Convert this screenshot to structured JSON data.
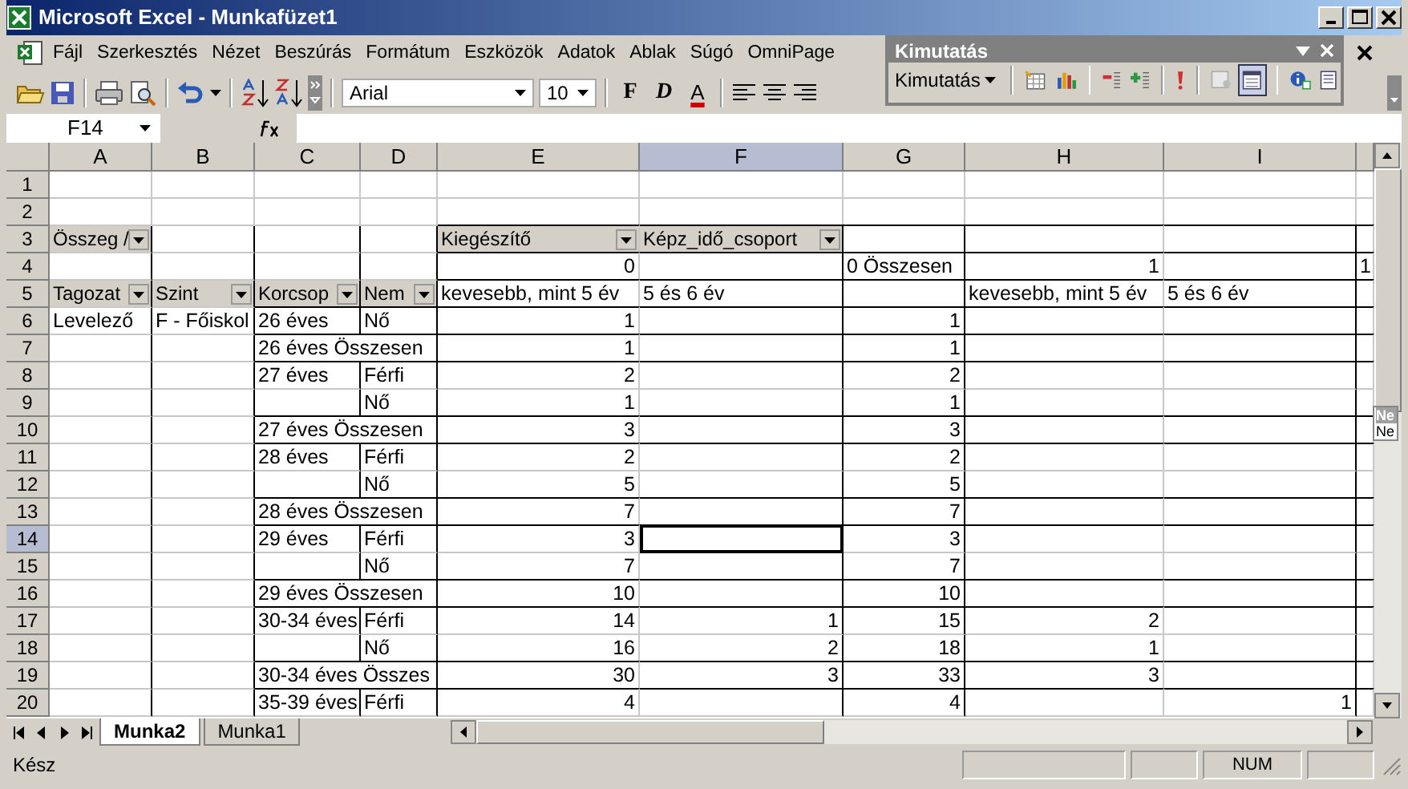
{
  "window": {
    "title": "Microsoft Excel - Munkafüzet1"
  },
  "menu": [
    "Fájl",
    "Szerkesztés",
    "Nézet",
    "Beszúrás",
    "Formátum",
    "Eszközök",
    "Adatok",
    "Ablak",
    "Súgó",
    "OmniPage"
  ],
  "toolbar": {
    "font": "Arial",
    "size": "10",
    "format_buttons": [
      {
        "label": "F",
        "kind": "bold"
      },
      {
        "label": "D",
        "kind": "italic"
      },
      {
        "label": "A",
        "kind": "color"
      }
    ]
  },
  "formula_bar": {
    "name_box": "F14"
  },
  "pivot_toolbar": {
    "title": "Kimutatás",
    "menu": "Kimutatás"
  },
  "columns": [
    {
      "label": "A",
      "selected": false
    },
    {
      "label": "B",
      "selected": false
    },
    {
      "label": "C",
      "selected": false
    },
    {
      "label": "D",
      "selected": false
    },
    {
      "label": "E",
      "selected": false
    },
    {
      "label": "F",
      "selected": true
    },
    {
      "label": "G",
      "selected": false
    },
    {
      "label": "H",
      "selected": false
    },
    {
      "label": "I",
      "selected": false
    }
  ],
  "rows": [
    {
      "number": "1",
      "selected": false,
      "cells": []
    },
    {
      "number": "2",
      "selected": false,
      "cells": []
    },
    {
      "number": "3",
      "selected": false,
      "cells": [
        {
          "text": "Összeg /",
          "kind": "field"
        },
        null,
        null,
        null,
        {
          "text": "Kiegészítő",
          "kind": "field"
        },
        {
          "text": "Képz_idő_csoport",
          "kind": "field"
        }
      ]
    },
    {
      "number": "4",
      "selected": false,
      "cells": [
        null,
        null,
        null,
        null,
        {
          "text": "0",
          "kind": "number"
        },
        null,
        {
          "text": "0 Összesen",
          "kind": "text"
        },
        {
          "text": "1",
          "kind": "number"
        },
        null,
        {
          "text": "1",
          "kind": "text"
        }
      ]
    },
    {
      "number": "5",
      "selected": false,
      "cells": [
        {
          "text": "Tagozat",
          "kind": "field"
        },
        {
          "text": "Szint",
          "kind": "field"
        },
        {
          "text": "Korcsop",
          "kind": "field"
        },
        {
          "text": "Nem",
          "kind": "field"
        },
        {
          "text": "kevesebb, mint 5 év",
          "kind": "text"
        },
        {
          "text": "5 és 6 év",
          "kind": "text"
        },
        null,
        {
          "text": "kevesebb, mint 5 év",
          "kind": "text"
        },
        {
          "text": "5 és 6 év",
          "kind": "text"
        }
      ]
    },
    {
      "number": "6",
      "selected": false,
      "cells": [
        {
          "text": "Levelező",
          "kind": "text"
        },
        {
          "text": "F - Főiskol",
          "kind": "text"
        },
        {
          "text": "26 éves",
          "kind": "text"
        },
        {
          "text": "Nő",
          "kind": "text"
        },
        {
          "text": "1",
          "kind": "number"
        },
        null,
        {
          "text": "1",
          "kind": "number"
        }
      ]
    },
    {
      "number": "7",
      "selected": false,
      "cells": [
        null,
        null,
        {
          "text": "26 éves Összesen",
          "kind": "text"
        },
        null,
        {
          "text": "1",
          "kind": "number"
        },
        null,
        {
          "text": "1",
          "kind": "number"
        }
      ]
    },
    {
      "number": "8",
      "selected": false,
      "cells": [
        null,
        null,
        {
          "text": "27 éves",
          "kind": "text"
        },
        {
          "text": "Férfi",
          "kind": "text"
        },
        {
          "text": "2",
          "kind": "number"
        },
        null,
        {
          "text": "2",
          "kind": "number"
        }
      ]
    },
    {
      "number": "9",
      "selected": false,
      "cells": [
        null,
        null,
        null,
        {
          "text": "Nő",
          "kind": "text"
        },
        {
          "text": "1",
          "kind": "number"
        },
        null,
        {
          "text": "1",
          "kind": "number"
        }
      ]
    },
    {
      "number": "10",
      "selected": false,
      "cells": [
        null,
        null,
        {
          "text": "27 éves Összesen",
          "kind": "text"
        },
        null,
        {
          "text": "3",
          "kind": "number"
        },
        null,
        {
          "text": "3",
          "kind": "number"
        }
      ]
    },
    {
      "number": "11",
      "selected": false,
      "cells": [
        null,
        null,
        {
          "text": "28 éves",
          "kind": "text"
        },
        {
          "text": "Férfi",
          "kind": "text"
        },
        {
          "text": "2",
          "kind": "number"
        },
        null,
        {
          "text": "2",
          "kind": "number"
        }
      ]
    },
    {
      "number": "12",
      "selected": false,
      "cells": [
        null,
        null,
        null,
        {
          "text": "Nő",
          "kind": "text"
        },
        {
          "text": "5",
          "kind": "number"
        },
        null,
        {
          "text": "5",
          "kind": "number"
        }
      ]
    },
    {
      "number": "13",
      "selected": false,
      "cells": [
        null,
        null,
        {
          "text": "28 éves Összesen",
          "kind": "text"
        },
        null,
        {
          "text": "7",
          "kind": "number"
        },
        null,
        {
          "text": "7",
          "kind": "number"
        }
      ]
    },
    {
      "number": "14",
      "selected": true,
      "cells": [
        null,
        null,
        {
          "text": "29 éves",
          "kind": "text"
        },
        {
          "text": "Férfi",
          "kind": "text"
        },
        {
          "text": "3",
          "kind": "number"
        },
        null,
        {
          "text": "3",
          "kind": "number"
        }
      ]
    },
    {
      "number": "15",
      "selected": false,
      "cells": [
        null,
        null,
        null,
        {
          "text": "Nő",
          "kind": "text"
        },
        {
          "text": "7",
          "kind": "number"
        },
        null,
        {
          "text": "7",
          "kind": "number"
        }
      ]
    },
    {
      "number": "16",
      "selected": false,
      "cells": [
        null,
        null,
        {
          "text": "29 éves Összesen",
          "kind": "text"
        },
        null,
        {
          "text": "10",
          "kind": "number"
        },
        null,
        {
          "text": "10",
          "kind": "number"
        }
      ]
    },
    {
      "number": "17",
      "selected": false,
      "cells": [
        null,
        null,
        {
          "text": "30-34 éves",
          "kind": "text"
        },
        {
          "text": "Férfi",
          "kind": "text"
        },
        {
          "text": "14",
          "kind": "number"
        },
        {
          "text": "1",
          "kind": "number"
        },
        {
          "text": "15",
          "kind": "number"
        },
        {
          "text": "2",
          "kind": "number"
        }
      ]
    },
    {
      "number": "18",
      "selected": false,
      "cells": [
        null,
        null,
        null,
        {
          "text": "Nő",
          "kind": "text"
        },
        {
          "text": "16",
          "kind": "number"
        },
        {
          "text": "2",
          "kind": "number"
        },
        {
          "text": "18",
          "kind": "number"
        },
        {
          "text": "1",
          "kind": "number"
        }
      ]
    },
    {
      "number": "19",
      "selected": false,
      "cells": [
        null,
        null,
        {
          "text": "30-34 éves Összes",
          "kind": "text"
        },
        null,
        {
          "text": "30",
          "kind": "number"
        },
        {
          "text": "3",
          "kind": "number"
        },
        {
          "text": "33",
          "kind": "number"
        },
        {
          "text": "3",
          "kind": "number"
        }
      ]
    },
    {
      "number": "20",
      "selected": false,
      "cells": [
        null,
        null,
        {
          "text": "35-39 éves",
          "kind": "text"
        },
        {
          "text": "Férfi",
          "kind": "text"
        },
        {
          "text": "4",
          "kind": "number"
        },
        null,
        {
          "text": "4",
          "kind": "number"
        },
        null,
        {
          "text": "1",
          "kind": "number"
        }
      ]
    }
  ],
  "sheet_tabs": [
    {
      "label": "Munka2",
      "selected": true
    },
    {
      "label": "Munka1",
      "selected": false
    }
  ],
  "status_bar": {
    "text": "Kész",
    "indicator": "NUM"
  },
  "side_popup": {
    "title": "Ne",
    "text": "Ne"
  }
}
